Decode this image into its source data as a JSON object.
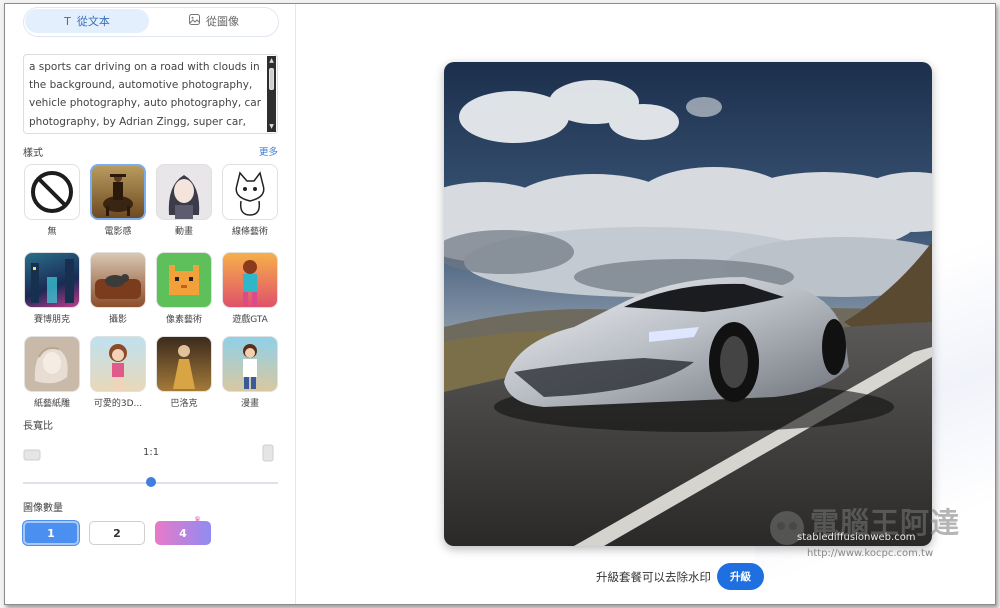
{
  "tabs": [
    {
      "label": "從文本",
      "icon": "text-icon"
    },
    {
      "label": "從圖像",
      "icon": "image-icon"
    }
  ],
  "prompt": {
    "value": "a sports car driving on a road with clouds in the background, automotive photography, vehicle photography, auto photography, car photography, by Adrian Zingg, super car, marc"
  },
  "style_section": {
    "label": "樣式",
    "more": "更多",
    "items": [
      {
        "label": "無"
      },
      {
        "label": "電影感"
      },
      {
        "label": "動畫"
      },
      {
        "label": "線條藝術"
      },
      {
        "label": "賽博朋克"
      },
      {
        "label": "攝影"
      },
      {
        "label": "像素藝術"
      },
      {
        "label": "遊戲GTA"
      },
      {
        "label": "紙藝紙雕"
      },
      {
        "label": "可愛的3D..."
      },
      {
        "label": "巴洛克"
      },
      {
        "label": "漫畫"
      }
    ],
    "selected": "電影感"
  },
  "aspect_ratio": {
    "label": "長寬比",
    "value": "1:1"
  },
  "image_count": {
    "label": "圖像數量",
    "options": [
      "1",
      "2",
      "4"
    ],
    "selected": "1"
  },
  "result": {
    "image_alt": "sports car on road",
    "upgrade_text": "升級套餐可以去除水印",
    "upgrade_button": "升級"
  },
  "watermark": {
    "title": "電腦王阿達",
    "site": "stablediffusionweb.com",
    "url": "http://www.kocpc.com.tw"
  },
  "colors": {
    "accent": "#1f6fe0",
    "tab_active_bg": "#e3effc"
  }
}
